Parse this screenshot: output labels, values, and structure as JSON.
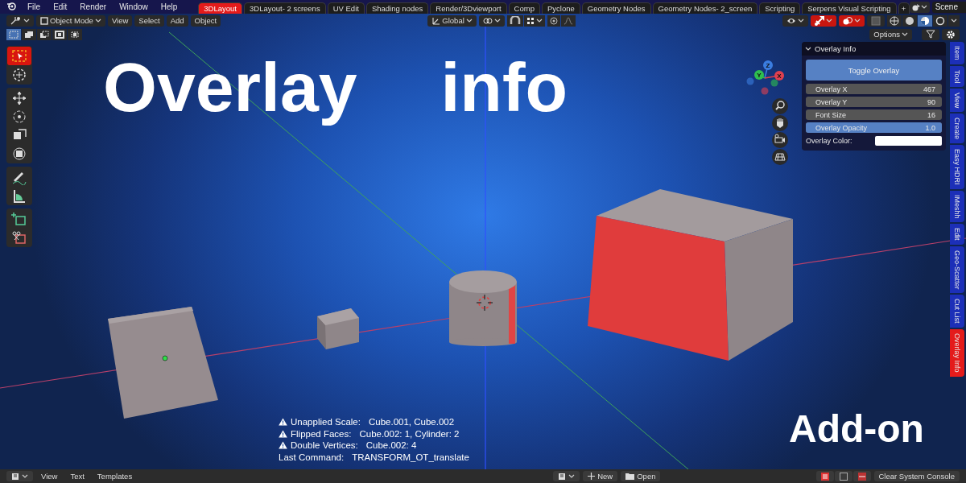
{
  "menu_bar": [
    "File",
    "Edit",
    "Render",
    "Window",
    "Help"
  ],
  "workspace_tabs": [
    {
      "label": "3DLayout",
      "selected": true
    },
    {
      "label": "3DLayout- 2 screens",
      "selected": false
    },
    {
      "label": "UV Edit",
      "selected": false
    },
    {
      "label": "Shading nodes",
      "selected": false
    },
    {
      "label": "Render/3Dviewport",
      "selected": false
    },
    {
      "label": "Comp",
      "selected": false
    },
    {
      "label": "Pyclone",
      "selected": false
    },
    {
      "label": "Geometry Nodes",
      "selected": false
    },
    {
      "label": "Geometry Nodes- 2_screen",
      "selected": false
    },
    {
      "label": "Scripting",
      "selected": false
    },
    {
      "label": "Serpens Visual Scripting",
      "selected": false
    }
  ],
  "add_tab": "+",
  "scene": "Scene",
  "header": {
    "mode": "Object Mode",
    "menus": [
      "View",
      "Select",
      "Add",
      "Object"
    ],
    "orientation": "Global",
    "toggles": [
      {
        "kind": "visibility",
        "on": false
      },
      {
        "kind": "gizmo",
        "on": true
      },
      {
        "kind": "overlay",
        "on": true
      },
      {
        "kind": "xray",
        "on": false
      }
    ],
    "shading": [
      {
        "kind": "wireframe",
        "selected": false
      },
      {
        "kind": "solid",
        "selected": false
      },
      {
        "kind": "material",
        "selected": true
      },
      {
        "kind": "rendered",
        "selected": false
      }
    ],
    "select_modes": [
      {
        "kind": "new",
        "selected": true
      },
      {
        "kind": "extend",
        "selected": false
      },
      {
        "kind": "subtract",
        "selected": false
      },
      {
        "kind": "invert",
        "selected": false
      },
      {
        "kind": "intersect",
        "selected": false
      }
    ],
    "options": "Options"
  },
  "tools": [
    [
      {
        "kind": "select",
        "selected": true
      },
      {
        "kind": "cursor",
        "selected": false
      }
    ],
    [
      {
        "kind": "move",
        "selected": false
      },
      {
        "kind": "rotate",
        "selected": false
      },
      {
        "kind": "scale",
        "selected": false
      },
      {
        "kind": "transform",
        "selected": false
      }
    ],
    [
      {
        "kind": "annotate",
        "selected": false
      },
      {
        "kind": "measure",
        "selected": false
      }
    ],
    [
      {
        "kind": "add-cube",
        "selected": false
      },
      {
        "kind": "cut",
        "selected": false
      }
    ]
  ],
  "viewport": {
    "title": "Overlay info",
    "badge": "Add-on",
    "gizmo": [
      {
        "label": "Z",
        "color": "#3b7de0"
      },
      {
        "label": "Y",
        "color": "#2fbf4f"
      },
      {
        "label": "X",
        "color": "#e0404f"
      }
    ],
    "info_lines": [
      {
        "kind": "warning",
        "label": "Unapplied Scale:",
        "value": "Cube.001, Cube.002"
      },
      {
        "kind": "warning",
        "label": "Flipped Faces:",
        "value": "Cube.002: 1, Cylinder: 2"
      },
      {
        "kind": "warning",
        "label": "Double Vertices:",
        "value": "Cube.002: 4"
      },
      {
        "kind": "plain",
        "label": "Last Command:",
        "value": "TRANSFORM_OT_translate"
      }
    ]
  },
  "panel": {
    "title": "Overlay Info",
    "expanded": true,
    "button": "Toggle Overlay",
    "fields": [
      {
        "kind": "number",
        "label": "Overlay X",
        "value": "467"
      },
      {
        "kind": "number",
        "label": "Overlay Y",
        "value": "90"
      },
      {
        "kind": "number",
        "label": "Font Size",
        "value": "16"
      },
      {
        "kind": "slider",
        "label": "Overlay Opacity",
        "value": "1.0",
        "level": 1.0
      }
    ],
    "color_label": "Overlay Color:",
    "color": "#ffffff"
  },
  "sidebar_tabs": [
    {
      "label": "Item",
      "selected": false
    },
    {
      "label": "Tool",
      "selected": false
    },
    {
      "label": "View",
      "selected": false
    },
    {
      "label": "Create",
      "selected": false
    },
    {
      "label": "Easy HDRI",
      "selected": false
    },
    {
      "label": "IMeshh",
      "selected": false
    },
    {
      "label": "Edit",
      "selected": false
    },
    {
      "label": "Geo-Scatter",
      "selected": false
    },
    {
      "label": "Cut List",
      "selected": false
    },
    {
      "label": "Overlay Info",
      "selected": true
    }
  ],
  "bottom_bar": {
    "menus": [
      "View",
      "Text",
      "Templates"
    ],
    "new": "New",
    "open": "Open",
    "console": "Clear System Console"
  }
}
